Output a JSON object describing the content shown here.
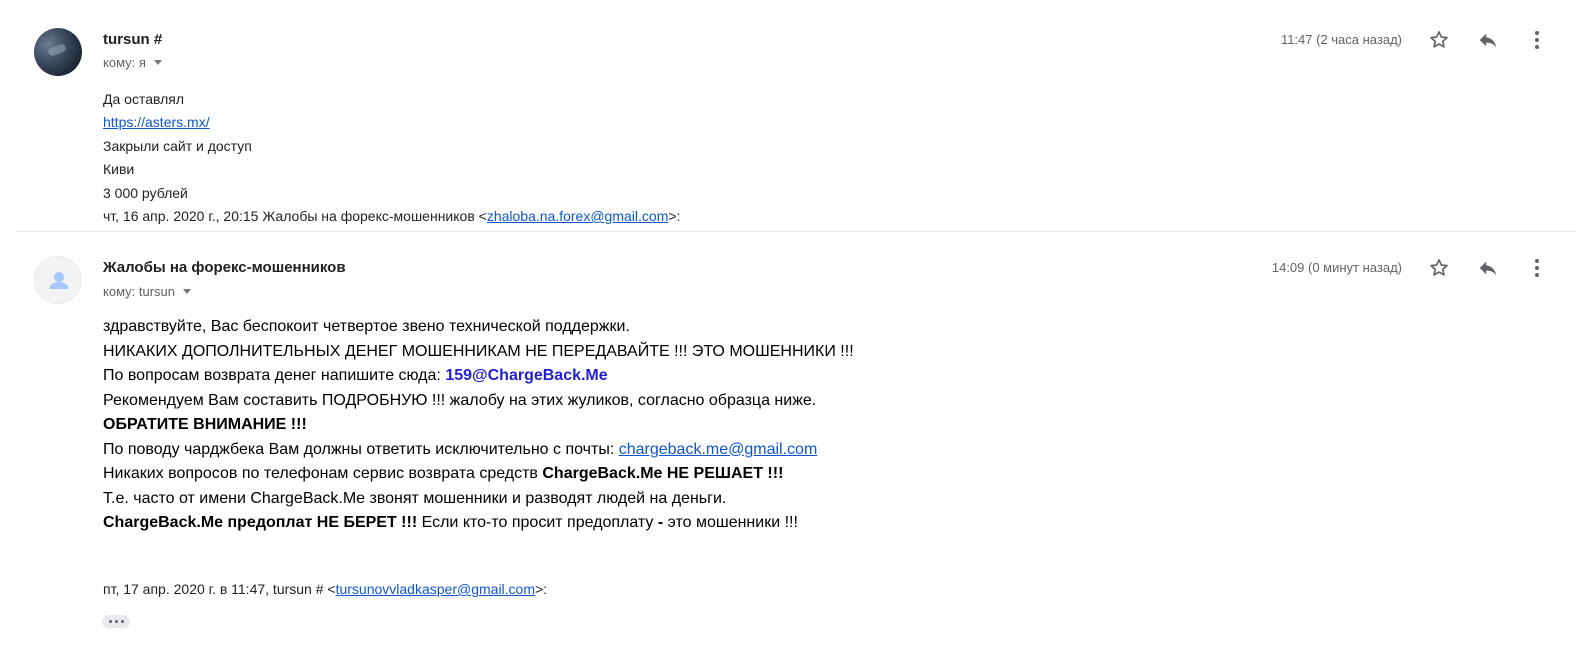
{
  "messages": [
    {
      "sender": "tursun #",
      "recipient": "кому: я",
      "time": "11:47 (2 часа назад)",
      "body": [
        {
          "text": "Да оставлял"
        },
        {
          "link": "https://asters.mx/"
        },
        {
          "text": "Закрыли сайт и доступ"
        },
        {
          "text": "Киви"
        },
        {
          "text": "3 000 рублей"
        }
      ],
      "quote_header": {
        "prefix": "чт, 16 апр. 2020 г., 20:15 Жалобы на форекс-мошенников <",
        "email": "zhaloba.na.forex@gmail.com",
        "suffix": ">:"
      }
    },
    {
      "sender": "Жалобы на форекс-мошенников",
      "recipient": "кому: tursun",
      "time": "14:09 (0 минут назад)",
      "lines": {
        "l1": "здравствуйте, Вас беспокоит четвертое звено технической поддержки.",
        "l2": "НИКАКИХ ДОПОЛНИТЕЛЬНЫХ ДЕНЕГ МОШЕННИКАМ НЕ ПЕРЕДАВАЙТЕ !!! ЭТО МОШЕННИКИ !!!",
        "l3_prefix": "По вопросам возврата денег напишите сюда: ",
        "l3_email": "159@ChargeBack.Me",
        "l4": "Рекомендуем Вам составить ПОДРОБНУЮ !!! жалобу на этих жуликов, согласно образца ниже.",
        "l5": "ОБРАТИТЕ ВНИМАНИЕ !!!",
        "l6_prefix": "По поводу чарджбека Вам должны ответить исключительно с почты: ",
        "l6_email": "chargeback.me@gmail.com",
        "l7_prefix": "Никаких вопросов по телефонам сервис возврата средств ",
        "l7_bold": "ChargeBack.Me НЕ РЕШАЕТ !!!",
        "l8": "Т.е. часто от имени ChargeBack.Me звонят мошенники и разводят людей на деньги.",
        "l9_bold1": "ChargeBack.Me предоплат НЕ БЕРЕТ !!!",
        "l9_mid": " Если кто-то просит предоплату ",
        "l9_bold2": "-",
        "l9_end": " это мошенники !!!"
      },
      "quote_header": {
        "prefix": "пт, 17 апр. 2020 г. в 11:47, tursun # <",
        "email": "tursunovvladkasper@gmail.com",
        "suffix": ">:"
      }
    }
  ],
  "icons": {
    "star": "star-icon",
    "reply": "reply-icon",
    "more": "more-vert-icon",
    "expand": "show-trimmed-content-icon"
  },
  "colors": {
    "link": "#1155cc",
    "email_highlight": "#2222cc",
    "divider": "#e8eaed"
  }
}
